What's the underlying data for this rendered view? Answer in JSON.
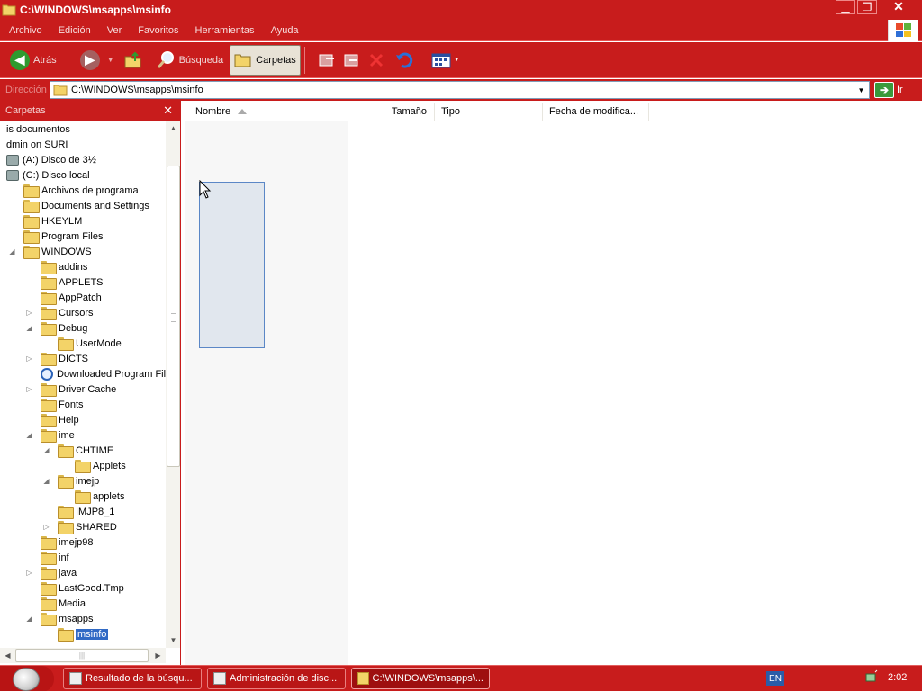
{
  "window": {
    "title": "C:\\WINDOWS\\msapps\\msinfo"
  },
  "menu": [
    "Archivo",
    "Edición",
    "Ver",
    "Favoritos",
    "Herramientas",
    "Ayuda"
  ],
  "toolbar": {
    "back_label": "Atrás",
    "search_label": "Búsqueda",
    "folders_label": "Carpetas"
  },
  "address": {
    "label": "Dirección",
    "value": "C:\\WINDOWS\\msapps\\msinfo",
    "go_label": "Ir"
  },
  "folders": {
    "title": "Carpetas",
    "close_glyph": "✕",
    "tree": [
      {
        "label": "is documentos",
        "type": "none",
        "depth": 0,
        "expander": ""
      },
      {
        "label": "dmin on SURI",
        "type": "none",
        "depth": 0,
        "expander": ""
      },
      {
        "label": "(A:) Disco de 3½",
        "type": "drive",
        "depth": 0,
        "expander": ""
      },
      {
        "label": "(C:) Disco local",
        "type": "drive",
        "depth": 0,
        "expander": "◢"
      },
      {
        "label": "Archivos de programa",
        "type": "folder",
        "depth": 1,
        "expander": ""
      },
      {
        "label": "Documents and Settings",
        "type": "folder",
        "depth": 1,
        "expander": ""
      },
      {
        "label": "HKEYLM",
        "type": "folder",
        "depth": 1,
        "expander": ""
      },
      {
        "label": "Program Files",
        "type": "folder",
        "depth": 1,
        "expander": ""
      },
      {
        "label": "WINDOWS",
        "type": "folder",
        "depth": 1,
        "expander": "◢"
      },
      {
        "label": "addins",
        "type": "folder",
        "depth": 2,
        "expander": ""
      },
      {
        "label": "APPLETS",
        "type": "folder",
        "depth": 2,
        "expander": ""
      },
      {
        "label": "AppPatch",
        "type": "folder",
        "depth": 2,
        "expander": ""
      },
      {
        "label": "Cursors",
        "type": "folder",
        "depth": 2,
        "expander": "▷"
      },
      {
        "label": "Debug",
        "type": "folder",
        "depth": 2,
        "expander": "◢"
      },
      {
        "label": "UserMode",
        "type": "folder",
        "depth": 3,
        "expander": ""
      },
      {
        "label": "DICTS",
        "type": "folder",
        "depth": 2,
        "expander": "▷"
      },
      {
        "label": "Downloaded Program Files",
        "type": "ie",
        "depth": 2,
        "expander": ""
      },
      {
        "label": "Driver Cache",
        "type": "folder",
        "depth": 2,
        "expander": "▷"
      },
      {
        "label": "Fonts",
        "type": "folder",
        "depth": 2,
        "expander": ""
      },
      {
        "label": "Help",
        "type": "folder",
        "depth": 2,
        "expander": ""
      },
      {
        "label": "ime",
        "type": "folder",
        "depth": 2,
        "expander": "◢"
      },
      {
        "label": "CHTIME",
        "type": "folder",
        "depth": 3,
        "expander": "◢"
      },
      {
        "label": "Applets",
        "type": "folder",
        "depth": 4,
        "expander": ""
      },
      {
        "label": "imejp",
        "type": "folder",
        "depth": 3,
        "expander": "◢"
      },
      {
        "label": "applets",
        "type": "folder",
        "depth": 4,
        "expander": ""
      },
      {
        "label": "IMJP8_1",
        "type": "folder",
        "depth": 3,
        "expander": ""
      },
      {
        "label": "SHARED",
        "type": "folder",
        "depth": 3,
        "expander": "▷"
      },
      {
        "label": "imejp98",
        "type": "folder",
        "depth": 2,
        "expander": ""
      },
      {
        "label": "inf",
        "type": "folder",
        "depth": 2,
        "expander": ""
      },
      {
        "label": "java",
        "type": "folder",
        "depth": 2,
        "expander": "▷"
      },
      {
        "label": "LastGood.Tmp",
        "type": "folder",
        "depth": 2,
        "expander": ""
      },
      {
        "label": "Media",
        "type": "folder",
        "depth": 2,
        "expander": ""
      },
      {
        "label": "msapps",
        "type": "folder",
        "depth": 2,
        "expander": "◢"
      },
      {
        "label": "msinfo",
        "type": "folder",
        "depth": 3,
        "expander": "",
        "selected": true
      }
    ]
  },
  "columns": [
    "Nombre",
    "Tamaño",
    "Tipo",
    "Fecha de modifica..."
  ],
  "taskbar": {
    "tasks": [
      "Resultado de la búsqu...",
      "Administración de disc...",
      "C:\\WINDOWS\\msapps\\..."
    ],
    "language": "EN",
    "clock": "2:02"
  },
  "colors": {
    "theme_red": "#c81c1c",
    "selection_blue": "#316ac5"
  }
}
